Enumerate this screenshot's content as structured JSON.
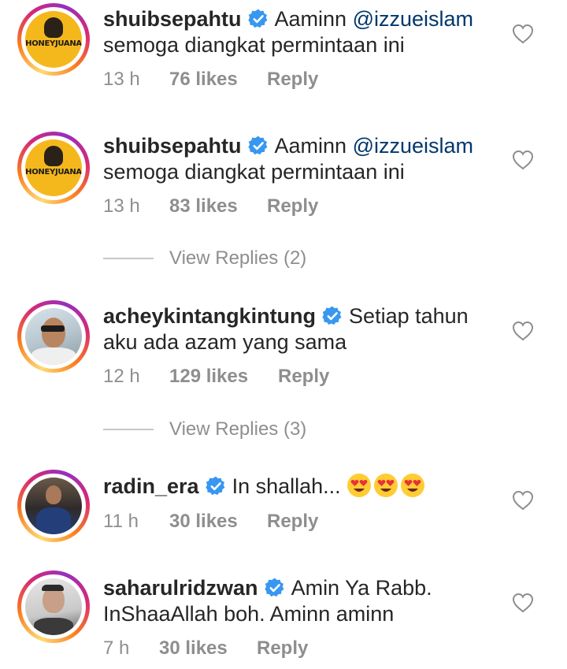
{
  "comments": [
    {
      "username": "shuibsepahtu",
      "text_plain": "Aaminn ",
      "mention": "@izzueislam",
      "text_line2": "semoga diangkat permintaan ini",
      "time": "13 h",
      "likes": "76 likes",
      "reply": "Reply",
      "avatar_text": "HONEYJUANA"
    },
    {
      "username": "shuibsepahtu",
      "text_plain": "Aaminn ",
      "mention": "@izzueislam",
      "text_line2": "semoga diangkat permintaan ini",
      "time": "13 h",
      "likes": "83 likes",
      "reply": "Reply",
      "avatar_text": "HONEYJUANA"
    },
    {
      "username": "acheykintangkintung",
      "text_line1": "Setiap tahun",
      "text_line2": "aku ada azam yang sama",
      "time": "12 h",
      "likes": "129 likes",
      "reply": "Reply"
    },
    {
      "username": "radin_era",
      "text_line1": "In shallah...",
      "emojis": [
        "heart-eyes-emoji",
        "heart-eyes-emoji",
        "heart-eyes-emoji"
      ],
      "time": "11 h",
      "likes": "30 likes",
      "reply": "Reply"
    },
    {
      "username": "saharulridzwan",
      "text_line1": "Amin Ya Rabb.",
      "text_line2": "InShaaAllah boh. Aminn aminn",
      "time": "7 h",
      "likes": "30 likes",
      "reply": "Reply"
    }
  ],
  "view_replies": [
    {
      "label": "View Replies (2)"
    },
    {
      "label": "View Replies (3)"
    }
  ],
  "colors": {
    "verified": "#3897f0",
    "mention": "#00376b",
    "meta": "#8e8e8e"
  }
}
